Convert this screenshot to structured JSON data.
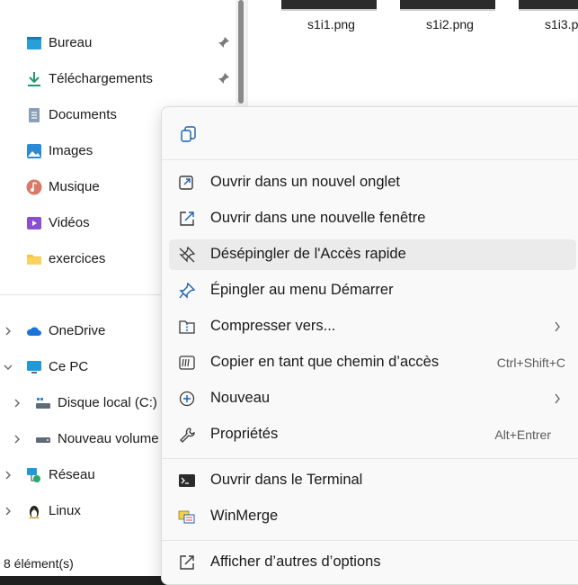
{
  "quick_access": [
    {
      "label": "Bureau",
      "icon": "desktop-icon",
      "pinned": true
    },
    {
      "label": "Téléchargements",
      "icon": "download-icon",
      "pinned": true
    },
    {
      "label": "Documents",
      "icon": "document-icon",
      "pinned": false
    },
    {
      "label": "Images",
      "icon": "image-icon",
      "pinned": false
    },
    {
      "label": "Musique",
      "icon": "music-icon",
      "pinned": false
    },
    {
      "label": "Vidéos",
      "icon": "video-icon",
      "pinned": false
    },
    {
      "label": "exercices",
      "icon": "folder-icon",
      "pinned": false
    }
  ],
  "tree": [
    {
      "label": "OneDrive",
      "icon": "cloud-icon",
      "chevron": "right"
    },
    {
      "label": "Ce PC",
      "icon": "monitor-icon",
      "chevron": "down"
    },
    {
      "label": "Disque local (C:)",
      "icon": "drive-icon",
      "chevron": "right"
    },
    {
      "label": "Nouveau volume",
      "icon": "drive-icon",
      "chevron": "right"
    },
    {
      "label": "Réseau",
      "icon": "network-icon",
      "chevron": "right"
    },
    {
      "label": "Linux",
      "icon": "linux-icon",
      "chevron": "right"
    }
  ],
  "status_bar": {
    "item_count": "8 élément(s)"
  },
  "files": [
    {
      "name": "s1i1.png"
    },
    {
      "name": "s1i2.png"
    },
    {
      "name": "s1i3.p"
    }
  ],
  "context_menu": {
    "top_action_icon": "copy-icon",
    "items": [
      {
        "label": "Ouvrir dans un nouvel onglet",
        "icon": "open-tab-icon",
        "shortcut": "",
        "submenu": false
      },
      {
        "label": "Ouvrir dans une nouvelle fenêtre",
        "icon": "open-window-icon",
        "shortcut": "",
        "submenu": false
      },
      {
        "label": "Désépingler de l'Accès rapide",
        "icon": "unpin-icon",
        "shortcut": "",
        "submenu": false,
        "hovered": true
      },
      {
        "label": "Épingler au menu Démarrer",
        "icon": "pin-icon",
        "shortcut": "",
        "submenu": false
      },
      {
        "label": "Compresser vers...",
        "icon": "zip-folder-icon",
        "shortcut": "",
        "submenu": true
      },
      {
        "label": "Copier en tant que chemin d’accès",
        "icon": "copy-path-icon",
        "shortcut": "Ctrl+Shift+C",
        "submenu": false
      },
      {
        "label": "Nouveau",
        "icon": "plus-circle-icon",
        "shortcut": "",
        "submenu": true
      },
      {
        "label": "Propriétés",
        "icon": "wrench-icon",
        "shortcut": "Alt+Entrer",
        "submenu": false
      },
      {
        "label": "Ouvrir dans le Terminal",
        "icon": "terminal-icon",
        "shortcut": "",
        "submenu": false
      },
      {
        "label": "WinMerge",
        "icon": "winmerge-icon",
        "shortcut": "",
        "submenu": false
      },
      {
        "label": "Afficher d’autres d’options",
        "icon": "more-options-icon",
        "shortcut": "",
        "submenu": false
      }
    ]
  },
  "colors": {
    "accent": "#0067c0",
    "hover": "#ebebeb",
    "menu_bg": "#f9f9f9",
    "folder": "#f5c542"
  }
}
